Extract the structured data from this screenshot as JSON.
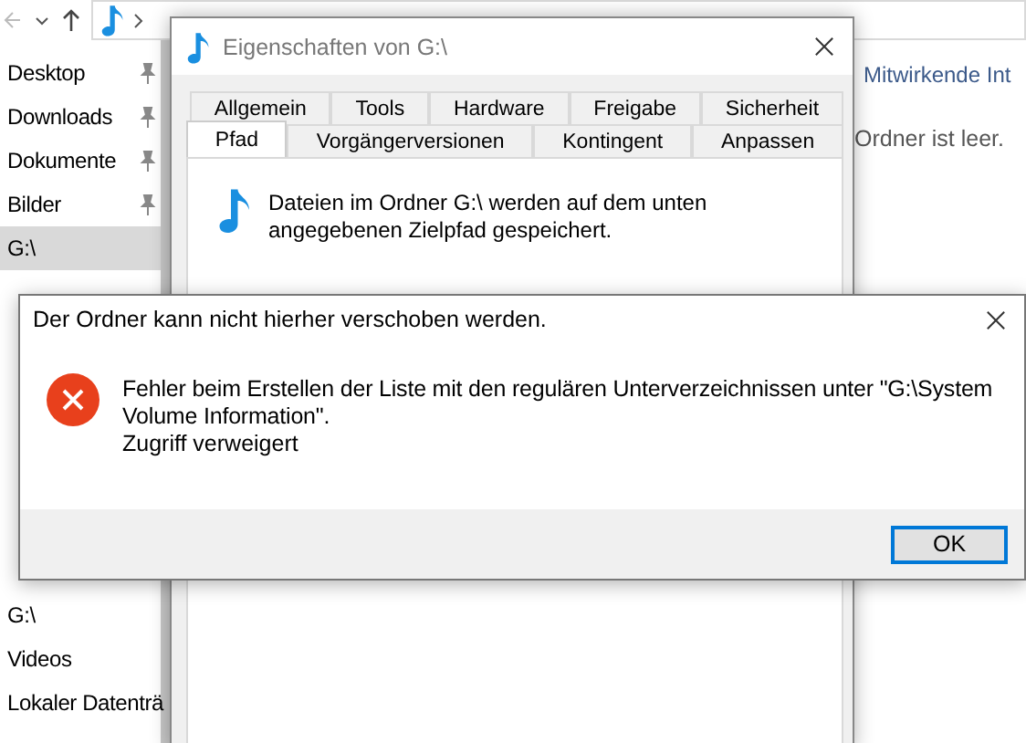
{
  "explorer": {
    "sidebar": {
      "items": [
        {
          "label": "Desktop",
          "pinned": true,
          "selected": false
        },
        {
          "label": "Downloads",
          "pinned": true,
          "selected": false
        },
        {
          "label": "Dokumente",
          "pinned": true,
          "selected": false
        },
        {
          "label": "Bilder",
          "pinned": true,
          "selected": false
        },
        {
          "label": "G:\\",
          "pinned": false,
          "selected": true
        }
      ],
      "lower_items": [
        {
          "label": "G:\\",
          "pinned": false,
          "selected": false
        },
        {
          "label": "Videos",
          "pinned": false,
          "selected": false
        },
        {
          "label": "Lokaler Datenträ",
          "pinned": false,
          "selected": false
        }
      ]
    },
    "column_header": "Mitwirkende Int",
    "empty_message": "Ordner ist leer."
  },
  "properties": {
    "title": "Eigenschaften von G:\\",
    "tab_rows": [
      [
        {
          "label": "Allgemein",
          "selected": false
        },
        {
          "label": "Tools",
          "selected": false
        },
        {
          "label": "Hardware",
          "selected": false
        },
        {
          "label": "Freigabe",
          "selected": false
        },
        {
          "label": "Sicherheit",
          "selected": false
        }
      ],
      [
        {
          "label": "Pfad",
          "selected": true
        },
        {
          "label": "Vorgängerversionen",
          "selected": false
        },
        {
          "label": "Kontingent",
          "selected": false
        },
        {
          "label": "Anpassen",
          "selected": false
        }
      ]
    ],
    "description": "Dateien im Ordner G:\\ werden auf dem unten angegebenen Zielpfad gespeichert."
  },
  "error_dialog": {
    "title": "Der Ordner kann nicht hierher verschoben werden.",
    "message": "Fehler beim Erstellen der Liste mit den regulären Unterverzeichnissen unter \"G:\\System Volume Information\".",
    "detail": "Zugriff verweigert",
    "buttons": [
      "OK"
    ]
  }
}
